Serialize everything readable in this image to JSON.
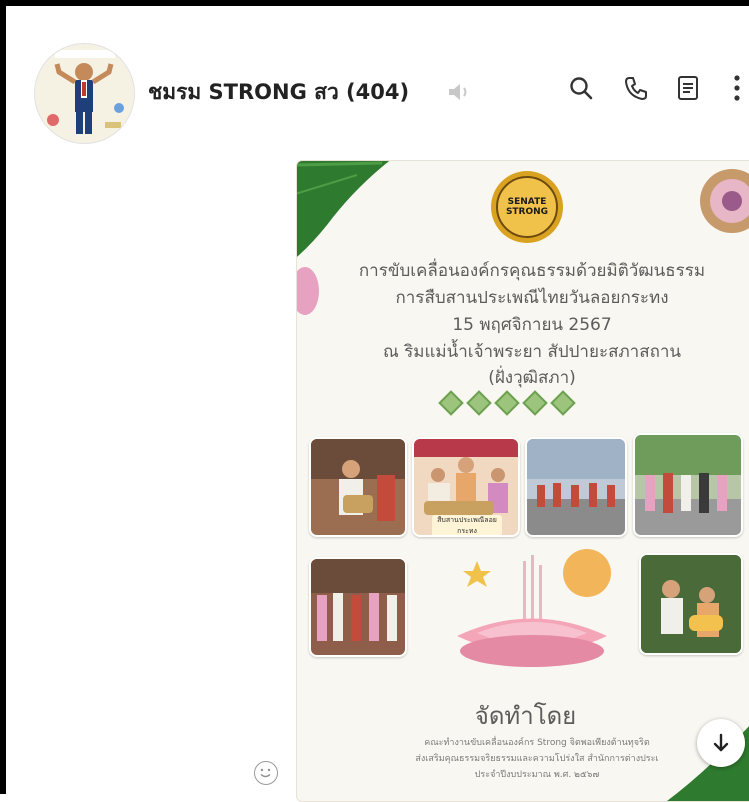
{
  "chat": {
    "title": "ชมรม STRONG สว (404)",
    "status_icon": "speaker-muted-icon"
  },
  "toolbar": {
    "icons": [
      "search-icon",
      "phone-icon",
      "notes-icon",
      "more-vertical-icon"
    ]
  },
  "message": {
    "logo_text": "SENATE STRONG",
    "poster_lines": [
      "การขับเคลื่อนองค์กรคุณธรรมด้วยมิติวัฒนธรรม",
      "การสืบสานประเพณีไทยวันลอยกระทง",
      "15 พฤศจิกายน 2567",
      "ณ ริมแม่น้ำเจ้าพระยา สัปปายะสภาสถาน",
      "(ฝั่งวุฒิสภา)"
    ],
    "photo_caption": "สืบสานประเพณีลอยกระทง",
    "organizer_title": "จัดทำโดย",
    "footer_lines": [
      "คณะทำงานขับเคลื่อนองค์กร Strong จิตพอเพียงต้านทุจริต",
      "ส่งเสริมคุณธรรมจริยธรรมและความโปร่งใส สำนักการต่างประเ",
      "ประจำปีงบประมาณ พ.ศ. ๒๕๖๗"
    ]
  },
  "colors": {
    "accent": "#6ea253",
    "leaf_green": "#2e7a2e",
    "gold": "#d9a321",
    "lotus_pink": "#f4a6b8"
  }
}
